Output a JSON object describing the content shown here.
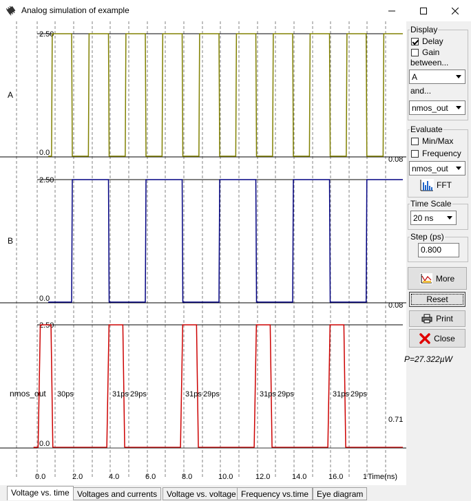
{
  "window": {
    "title": "Analog simulation of example",
    "icon": "chip-icon",
    "controls": [
      "minimize-icon",
      "maximize-icon",
      "close-icon"
    ]
  },
  "plot": {
    "traces": [
      {
        "label": "A",
        "y_max_label": "2.50",
        "y_min_label": "0.0",
        "right_label": "0.08",
        "color": "#808000",
        "edges": [
          0.78,
          1.87,
          2.78,
          3.87,
          4.78,
          5.87,
          6.78,
          7.87,
          8.78,
          9.87,
          10.78,
          11.87,
          12.78,
          13.87,
          14.78,
          15.87,
          16.78,
          17.86,
          18.78
        ],
        "start_level": "low"
      },
      {
        "label": "B",
        "y_max_label": "2.50",
        "y_min_label": "0.0",
        "right_label": "0.08",
        "color": "#000080",
        "edges": [
          1.87,
          3.87,
          5.87,
          7.87,
          9.87,
          11.87,
          13.87,
          15.87,
          17.86
        ],
        "start_level": "low"
      },
      {
        "label": "nmos_out",
        "y_max_label": "2.50",
        "y_min_label": "0.0",
        "right_label": "0.71",
        "color": "#cc0000",
        "rise_times": [
          0.05,
          3.78,
          7.78,
          11.78,
          15.78
        ],
        "fall_times": [
          0.75,
          4.65,
          8.65,
          12.65,
          16.65
        ],
        "delay_labels": [
          "30ps",
          "31ps",
          "29ps",
          "31ps",
          "29ps",
          "31ps",
          "29ps",
          "31ps",
          "29ps"
        ]
      }
    ],
    "x_axis": {
      "ticks": [
        "0.0",
        "2.0",
        "4.0",
        "6.0",
        "8.0",
        "10.0",
        "12.0",
        "14.0",
        "16.0",
        "1"
      ],
      "unit_label": "Time(ns)"
    }
  },
  "panel": {
    "display": {
      "legend": "Display",
      "delay": {
        "label": "Delay",
        "checked": true
      },
      "gain": {
        "label": "Gain",
        "checked": false
      },
      "between_label": "between...",
      "between_value": "A",
      "and_label": "and...",
      "and_value": "nmos_out"
    },
    "evaluate": {
      "legend": "Evaluate",
      "minmax": {
        "label": "Min/Max",
        "checked": false
      },
      "frequency": {
        "label": "Frequency",
        "checked": false
      },
      "signal_value": "nmos_out",
      "fft_label": "FFT"
    },
    "time_scale": {
      "legend": "Time Scale",
      "value": "20 ns"
    },
    "step": {
      "legend": "Step (ps)",
      "value": "0.800"
    },
    "buttons": {
      "more": "More",
      "reset": "Reset",
      "print": "Print",
      "close": "Close"
    },
    "power": "P=27.322µW"
  },
  "tabs": [
    {
      "label": "Voltage vs. time",
      "active": true
    },
    {
      "label": "Voltages and currents",
      "active": false
    },
    {
      "label": "Voltage vs. voltage",
      "active": false
    },
    {
      "label": "Frequency vs.time",
      "active": false
    },
    {
      "label": "Eye diagram",
      "active": false
    }
  ]
}
